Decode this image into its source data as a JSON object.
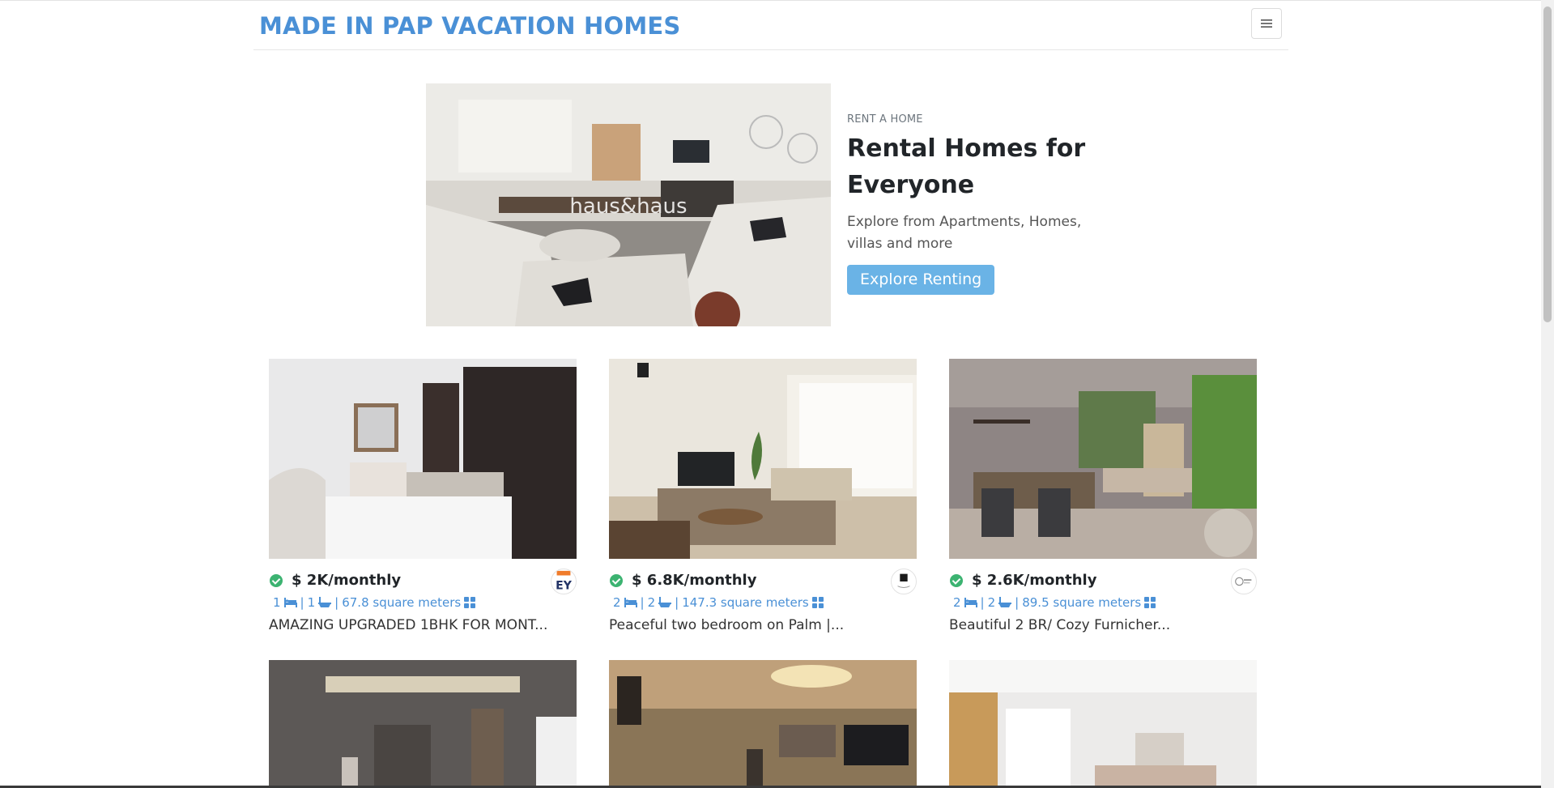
{
  "navbar": {
    "brand": "MADE IN PAP VACATION HOMES",
    "menu_icon": "hamburger-icon"
  },
  "hero": {
    "eyebrow": "RENT A HOME",
    "title": "Rental Homes for Everyone",
    "description": "Explore from Apartments, Homes, villas and more",
    "button_label": "Explore Renting",
    "image_watermark": "haus&haus"
  },
  "listings": [
    {
      "price": "$ 2K/monthly",
      "beds": "1",
      "baths": "1",
      "area": "67.8 square meters",
      "title": "AMAZING UPGRADED 1BHK FOR MONT...",
      "agency_logo": "EY"
    },
    {
      "price": "$ 6.8K/monthly",
      "beds": "2",
      "baths": "2",
      "area": "147.3 square meters",
      "title": "Peaceful two bedroom on Palm |...",
      "agency_logo": ""
    },
    {
      "price": "$ 2.6K/monthly",
      "beds": "2",
      "baths": "2",
      "area": "89.5 square meters",
      "title": "Beautiful 2 BR/ Cozy Furnicher...",
      "agency_logo": ""
    }
  ],
  "icons": {
    "verified": "check-circle-icon",
    "bed": "bed-icon",
    "bath": "bath-icon",
    "area": "grid-icon"
  },
  "colors": {
    "brand": "#4a90d6",
    "button": "#6ab3e6",
    "verified": "#3cb371"
  }
}
